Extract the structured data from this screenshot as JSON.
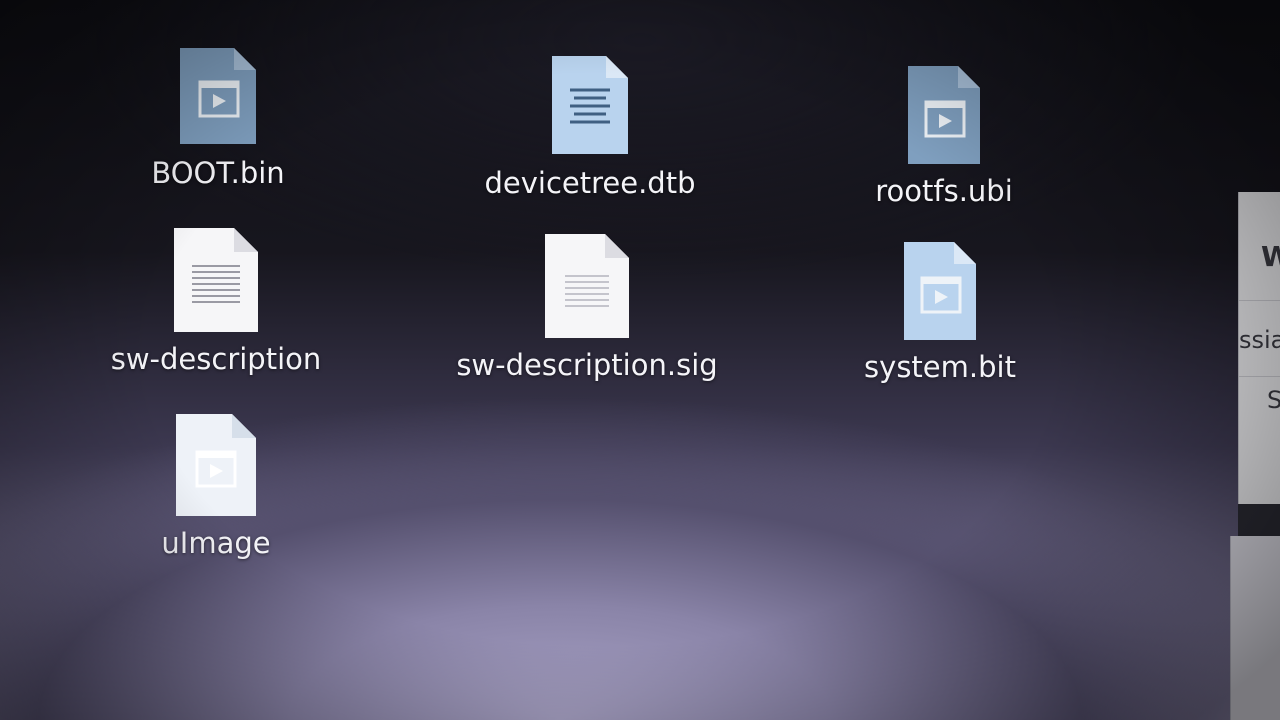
{
  "desktop": {
    "files": [
      {
        "name": "BOOT.bin",
        "icon": "media-file-icon"
      },
      {
        "name": "devicetree.dtb",
        "icon": "text-document-icon"
      },
      {
        "name": "rootfs.ubi",
        "icon": "media-file-icon"
      },
      {
        "name": "sw-description",
        "icon": "plain-document-icon"
      },
      {
        "name": "sw-description.sig",
        "icon": "plain-document-icon"
      },
      {
        "name": "system.bit",
        "icon": "media-file-icon"
      },
      {
        "name": "uImage",
        "icon": "media-file-icon"
      }
    ]
  },
  "side_window": {
    "heading_fragment": "W",
    "row1_fragment": "ssia",
    "row2_fragment": "S"
  },
  "colors": {
    "icon_blue": "#7f9fbf",
    "icon_light_blue": "#b9d3ee",
    "icon_white": "#f6f6f8",
    "label": "#f4f4f8"
  }
}
